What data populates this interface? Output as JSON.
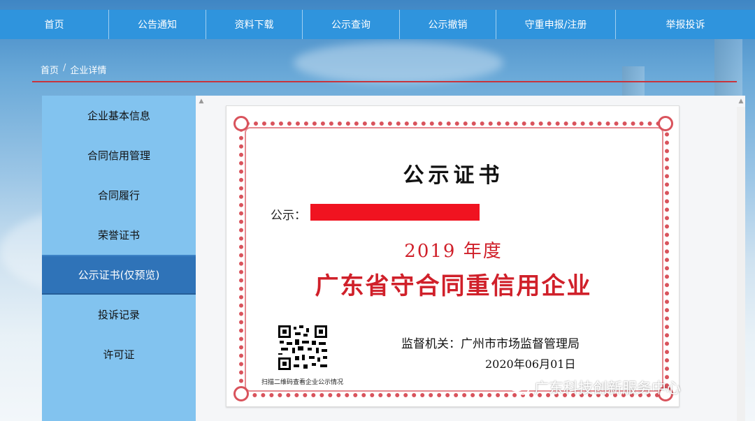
{
  "nav": {
    "items": [
      {
        "label": "首页"
      },
      {
        "label": "公告通知"
      },
      {
        "label": "资料下载"
      },
      {
        "label": "公示查询"
      },
      {
        "label": "公示撤销"
      },
      {
        "label": "守重申报/注册"
      },
      {
        "label": "举报投诉"
      }
    ]
  },
  "breadcrumb": {
    "home": "首页",
    "separator": "/",
    "current": "企业详情"
  },
  "sidebar": {
    "items": [
      {
        "label": "企业基本信息"
      },
      {
        "label": "合同信用管理"
      },
      {
        "label": "合同履行"
      },
      {
        "label": "荣誉证书"
      },
      {
        "label": "公示证书(仅预览)",
        "active": true
      },
      {
        "label": "投诉记录"
      },
      {
        "label": "许可证"
      }
    ]
  },
  "certificate": {
    "title": "公示证书",
    "recipient_prefix": "公示：",
    "year_line": "2019 年度",
    "honor": "广东省守合同重信用企业",
    "authority": "监督机关：广州市市场监督管理局",
    "date": "2020年06月01日",
    "qr_caption": "扫描二维码查看企业公示情况"
  },
  "watermark": {
    "text": "广东科技创新服务中心",
    "icon": "wechat-icon"
  },
  "colors": {
    "nav_bg": "#2f94dd",
    "sidebar_bg": "#82c3ef",
    "active_bg": "#2f73b8",
    "cert_red": "#d0202a",
    "divider_red": "#c8343c"
  }
}
